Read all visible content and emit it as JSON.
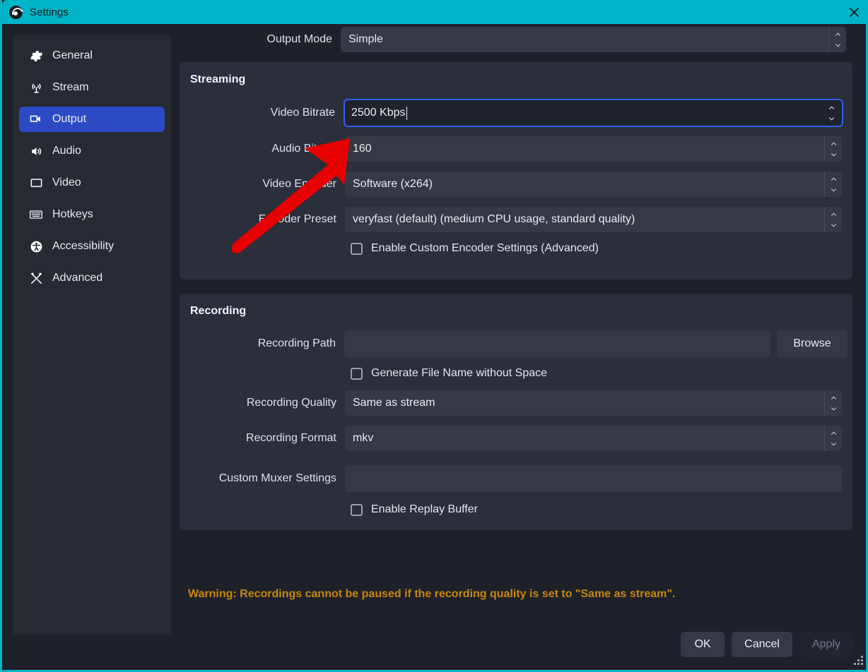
{
  "window": {
    "title": "Settings",
    "logo_icon": "obs-logo-icon",
    "close_icon": "close-icon",
    "accent_color": "#00b4c8",
    "background_color": "#1e2129",
    "panel_color": "#2b2e3b",
    "selection_color": "#2b4ac4"
  },
  "sidebar": {
    "items": [
      {
        "label": "General",
        "icon": "gear-icon",
        "selected": false
      },
      {
        "label": "Stream",
        "icon": "broadcast-icon",
        "selected": false
      },
      {
        "label": "Output",
        "icon": "output-screen-icon",
        "selected": true
      },
      {
        "label": "Audio",
        "icon": "speaker-icon",
        "selected": false
      },
      {
        "label": "Video",
        "icon": "monitor-icon",
        "selected": false
      },
      {
        "label": "Hotkeys",
        "icon": "keyboard-icon",
        "selected": false
      },
      {
        "label": "Accessibility",
        "icon": "accessibility-icon",
        "selected": false
      },
      {
        "label": "Advanced",
        "icon": "tools-icon",
        "selected": false
      }
    ]
  },
  "output_mode": {
    "label": "Output Mode",
    "value": "Simple"
  },
  "streaming": {
    "title": "Streaming",
    "video_bitrate": {
      "label": "Video Bitrate",
      "value": "2500 Kbps",
      "focused": true
    },
    "audio_bitrate": {
      "label": "Audio Bitrate",
      "value": "160"
    },
    "video_encoder": {
      "label": "Video Encoder",
      "value": "Software (x264)"
    },
    "encoder_preset": {
      "label": "Encoder Preset",
      "value": "veryfast (default) (medium CPU usage, standard quality)"
    },
    "custom_encoder_checkbox": {
      "label": "Enable Custom Encoder Settings (Advanced)",
      "checked": false
    }
  },
  "recording": {
    "title": "Recording",
    "recording_path": {
      "label": "Recording Path",
      "value": "",
      "browse_label": "Browse"
    },
    "generate_file_name_checkbox": {
      "label": "Generate File Name without Space",
      "checked": false
    },
    "recording_quality": {
      "label": "Recording Quality",
      "value": "Same as stream"
    },
    "recording_format": {
      "label": "Recording Format",
      "value": "mkv"
    },
    "custom_muxer": {
      "label": "Custom Muxer Settings",
      "value": ""
    },
    "replay_buffer_checkbox": {
      "label": "Enable Replay Buffer",
      "checked": false
    }
  },
  "warning": {
    "text": "Warning: Recordings cannot be paused if the recording quality is set to \"Same as stream\".",
    "color": "#c8860d"
  },
  "footer": {
    "ok_label": "OK",
    "cancel_label": "Cancel",
    "apply_label": "Apply",
    "apply_disabled": true
  },
  "annotation": {
    "type": "arrow",
    "color": "#e60000",
    "points_to": "Video Bitrate"
  }
}
